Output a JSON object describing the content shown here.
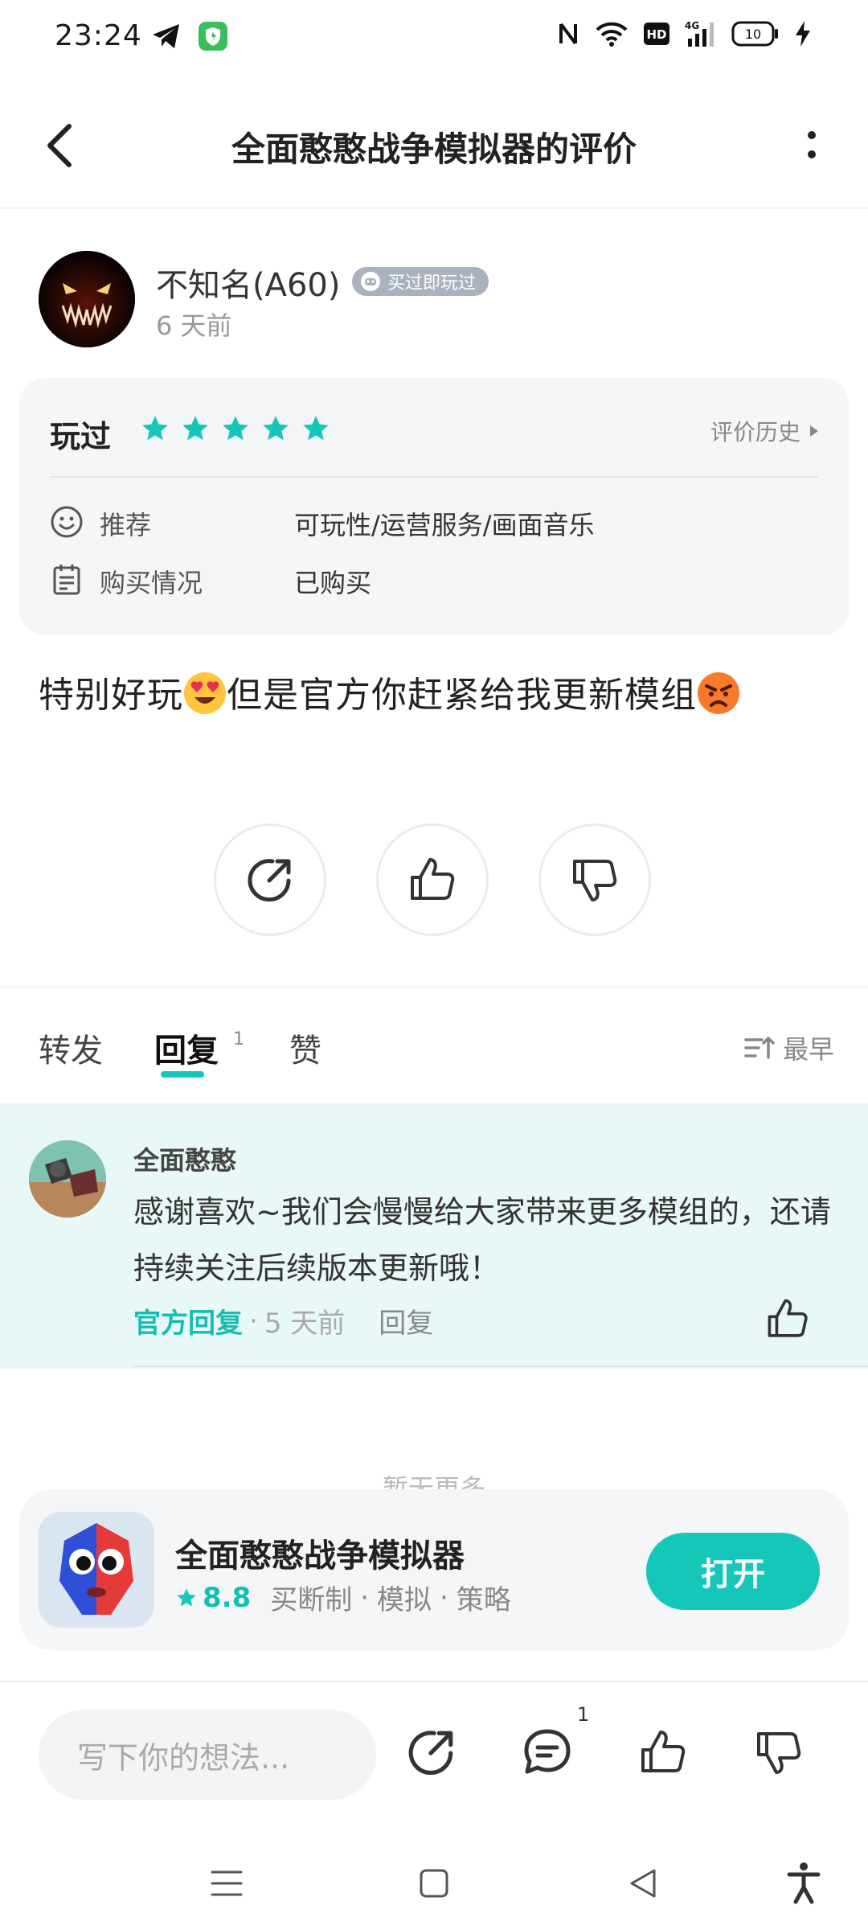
{
  "status_bar": {
    "time": "23:24",
    "battery": "10",
    "icons": [
      "telegram-icon",
      "shield-app-icon",
      "nfc-icon",
      "wifi-icon",
      "hd-icon",
      "signal-4g-icon",
      "battery-icon",
      "charging-icon"
    ]
  },
  "header": {
    "title": "全面憨憨战争模拟器的评价",
    "back_icon": "back-arrow-icon",
    "more_icon": "more-vertical-icon"
  },
  "review": {
    "author_name": "不知名(A60)",
    "badge": "买过即玩过",
    "time": "6 天前",
    "played_label": "玩过",
    "stars": 5,
    "history_label": "评价历史",
    "recommend_label": "推荐",
    "recommend_value": "可玩性/运营服务/画面音乐",
    "purchase_label": "购买情况",
    "purchase_value": "已购买",
    "text_part1": "特别好玩",
    "text_part2": "但是官方你赶紧给我更新模组"
  },
  "tabs": {
    "share": "转发",
    "reply": "回复",
    "reply_count": "1",
    "like": "赞",
    "sort": "最早"
  },
  "reply": {
    "name": "全面憨憨",
    "text": "感谢喜欢~我们会慢慢给大家带来更多模组的，还请持续关注后续版本更新哦！",
    "official": "官方回复",
    "dot": "·",
    "time": "5 天前",
    "action": "回复"
  },
  "no_more": "暂无更多",
  "app": {
    "name": "全面憨憨战争模拟器",
    "score": "8.8",
    "tag1": "买断制",
    "tag2": "模拟",
    "tag3": "策略",
    "sep": "·",
    "open": "打开"
  },
  "bottom_bar": {
    "placeholder": "写下你的想法...",
    "comment_count": "1"
  },
  "colors": {
    "accent": "#15c7b9",
    "reply_bg": "#e7f8f7",
    "card_bg": "#f4f6f7"
  }
}
